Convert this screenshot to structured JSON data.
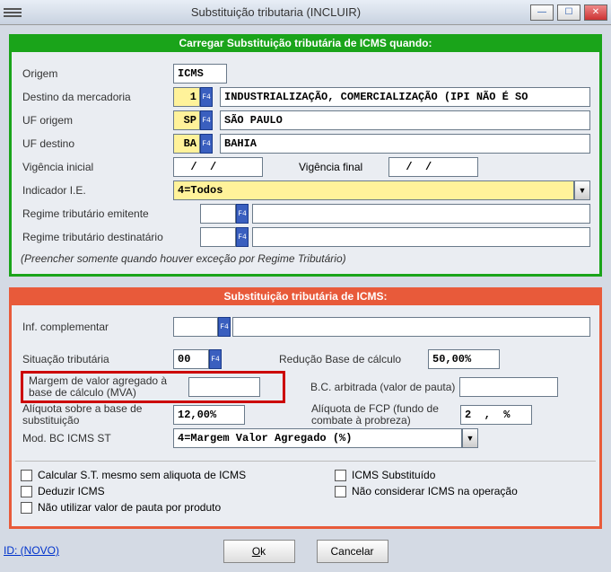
{
  "titlebar": {
    "title": "Substituição tributaria (INCLUIR)"
  },
  "panel1": {
    "title": "Carregar Substituição tributária de ICMS quando:",
    "origem": {
      "label": "Origem",
      "value": "ICMS"
    },
    "destino": {
      "label": "Destino da mercadoria",
      "code": "1",
      "desc": "INDUSTRIALIZAÇÃO, COMERCIALIZAÇÃO (IPI NÃO É SO"
    },
    "uforigem": {
      "label": "UF origem",
      "code": "SP",
      "desc": "SÃO PAULO"
    },
    "ufdestino": {
      "label": "UF destino",
      "code": "BA",
      "desc": "BAHIA"
    },
    "viginicial": {
      "label": "Vigência inicial",
      "value": "  /  /"
    },
    "vigfinal": {
      "label": "Vigência final",
      "value": "  /  /"
    },
    "indicador": {
      "label": "Indicador I.E.",
      "value": "4=Todos"
    },
    "regime_emit": {
      "label": "Regime tributário emitente",
      "code": "",
      "desc": ""
    },
    "regime_dest": {
      "label": "Regime tributário destinatário",
      "code": "",
      "desc": ""
    },
    "note": "(Preencher somente quando houver exceção por Regime Tributário)"
  },
  "panel2": {
    "title": "Substituição tributária de ICMS:",
    "inf": {
      "label": "Inf. complementar",
      "code": ""
    },
    "sit": {
      "label": "Situação tributária",
      "code": "00"
    },
    "reducao": {
      "label": "Redução Base de cálculo",
      "value": "50,00%"
    },
    "mva": {
      "label": "Margem de valor agregado à base de cálculo (MVA)",
      "value": ""
    },
    "bc_arb": {
      "label": "B.C. arbitrada (valor de pauta)",
      "value": ""
    },
    "aliquota": {
      "label": "Alíquota sobre a base de substituição",
      "value": "12,00%"
    },
    "fcp": {
      "label": "Alíquota de FCP (fundo de combate à probreza)",
      "value": "2  ,  %"
    },
    "mod": {
      "label": "Mod. BC ICMS ST",
      "value": "4=Margem Valor Agregado (%)"
    },
    "chk1": "Calcular S.T. mesmo sem aliquota de ICMS",
    "chk2": "ICMS Substituído",
    "chk3": "Deduzir  ICMS",
    "chk4": "Não considerar ICMS na operação",
    "chk5": "Não utilizar valor de pauta por produto"
  },
  "buttons": {
    "ok": "Ok",
    "cancel": "Cancelar"
  },
  "footer": {
    "id": "ID: (NOVO)"
  },
  "f4": "F4"
}
